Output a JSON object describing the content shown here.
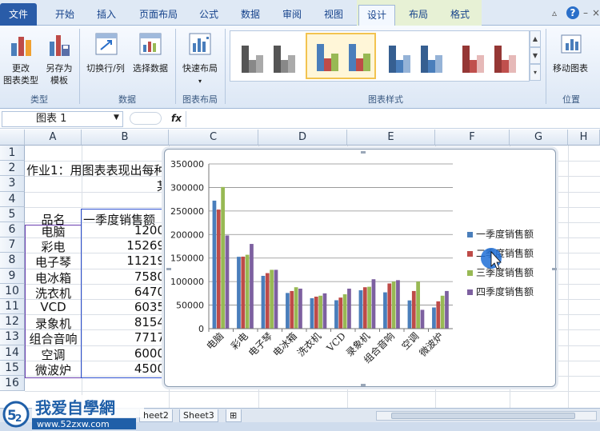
{
  "ribbon": {
    "tabs": [
      "文件",
      "开始",
      "插入",
      "页面布局",
      "公式",
      "数据",
      "审阅",
      "视图",
      "设计",
      "布局",
      "格式"
    ],
    "active_tab": "设计",
    "buttons": {
      "change_type_l1": "更改",
      "change_type_l2": "图表类型",
      "save_as_l1": "另存为",
      "save_as_l2": "模板",
      "switch_rowcol": "切换行/列",
      "select_data": "选择数据",
      "quick_layout": "快速布局",
      "move_chart": "移动图表"
    },
    "groups": {
      "type": "类型",
      "data": "数据",
      "layouts": "图表布局",
      "styles": "图表样式",
      "location": "位置"
    }
  },
  "formula_bar": {
    "name_box": "图表 1",
    "fx": "fx"
  },
  "sheet": {
    "columns": [
      "A",
      "B",
      "C",
      "D",
      "E",
      "F",
      "G",
      "H"
    ],
    "rows": [
      "1",
      "2",
      "3",
      "4",
      "5",
      "6",
      "7",
      "8",
      "9",
      "10",
      "11",
      "12",
      "13",
      "14",
      "15",
      "16"
    ],
    "title_text": "作业1：用图表表现出每种",
    "title_cont": "某",
    "header_name": "品名",
    "header_q1": "一季度销售额",
    "products": [
      "电脑",
      "彩电",
      "电子琴",
      "电冰箱",
      "洗衣机",
      "VCD",
      "录象机",
      "组合音响",
      "空调",
      "微波炉"
    ],
    "q1_values": [
      "1200",
      "15269",
      "11219",
      "7580",
      "6470",
      "6035",
      "8154",
      "7717",
      "6000",
      "4500"
    ],
    "sheet_tabs": [
      "heet2",
      "Sheet3"
    ]
  },
  "chart_data": {
    "type": "bar",
    "categories": [
      "电脑",
      "彩电",
      "电子琴",
      "电冰箱",
      "洗衣机",
      "VCD",
      "录象机",
      "组合音响",
      "空调",
      "微波炉"
    ],
    "series": [
      {
        "name": "一季度销售额",
        "color": "#4a7ebb",
        "values": [
          272000,
          152690,
          112190,
          75800,
          64700,
          60350,
          81540,
          77170,
          60000,
          45000
        ]
      },
      {
        "name": "二季度销售额",
        "color": "#be4b48",
        "values": [
          253000,
          153000,
          118000,
          80000,
          68000,
          66000,
          88000,
          96000,
          80000,
          58000
        ]
      },
      {
        "name": "三季度销售额",
        "color": "#98b954",
        "values": [
          301000,
          157000,
          125000,
          88000,
          70000,
          73000,
          89000,
          100000,
          100000,
          70000
        ]
      },
      {
        "name": "四季度销售额",
        "color": "#7d60a0",
        "values": [
          198000,
          180000,
          125000,
          85000,
          75000,
          85000,
          105000,
          103000,
          40000,
          80000
        ]
      }
    ],
    "ylim": [
      0,
      350000
    ],
    "yticks": [
      "0",
      "50000",
      "100000",
      "150000",
      "200000",
      "250000",
      "300000",
      "350000"
    ],
    "legend": "right",
    "grid": true
  },
  "watermark": {
    "text": "我爱自學網",
    "url": "www.52zxw.com"
  }
}
